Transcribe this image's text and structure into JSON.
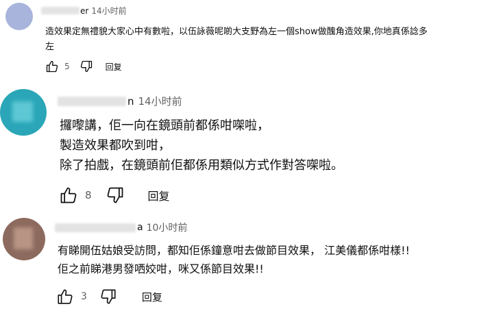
{
  "comments": [
    {
      "author_suffix": "er",
      "time": "14小时前",
      "lines": [
        "造效果定無禮貌大家心中有數啦，以伍詠薇呢啲大支野為左一個show做醜角造效果,你地真係諗多",
        "左"
      ],
      "likes": "5",
      "reply": "回复",
      "avatar": {
        "bg": "#a8b4dc"
      }
    },
    {
      "author_suffix": "n",
      "time": "14小时前",
      "lines": [
        "攞嚟講，佢一向在鏡頭前都係咁㗎啦，",
        "製造效果都吹到咁，",
        "除了拍戲，在鏡頭前佢都係用類似方式作對答㗎啦。"
      ],
      "likes": "8",
      "reply": "回复",
      "avatar": {
        "bg": "#2aa6b8",
        "accent": "#5ec7d4"
      }
    },
    {
      "author_suffix": "a",
      "time": "10小时前",
      "lines": [
        "有睇開伍姑娘受訪問，都知佢係鐘意咁去做節目效果， 江美儀都係咁樣!!",
        "佢之前睇港男發哂姣咁，咪又係節目效果!!"
      ],
      "likes": "3",
      "reply": "回复",
      "avatar": {
        "bg": "#8d6a5e",
        "accent": "#b89484"
      }
    }
  ]
}
